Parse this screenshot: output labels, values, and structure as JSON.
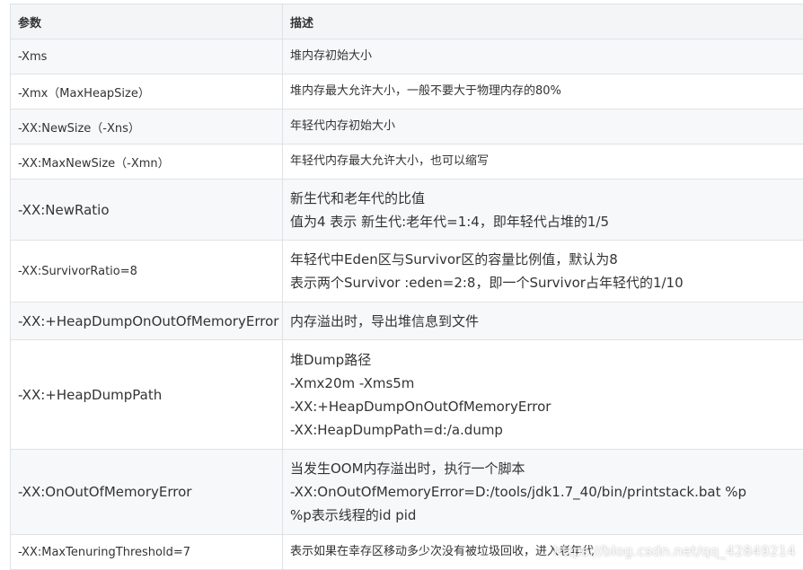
{
  "table": {
    "headers": [
      "参数",
      "描述"
    ],
    "rows": [
      {
        "param": "-Xms",
        "desc": [
          "堆内存初始大小"
        ]
      },
      {
        "param": "-Xmx（MaxHeapSize）",
        "desc": [
          "堆内存最大允许大小，一般不要大于物理内存的80%"
        ]
      },
      {
        "param": "-XX:NewSize（-Xns）",
        "desc": [
          "年轻代内存初始大小"
        ]
      },
      {
        "param": "-XX:MaxNewSize（-Xmn）",
        "desc": [
          "年轻代内存最大允许大小，也可以缩写"
        ]
      },
      {
        "param": "-XX:NewRatio",
        "desc": [
          "新生代和老年代的比值",
          "值为4 表示 新生代:老年代=1:4，即年轻代占堆的1/5"
        ]
      },
      {
        "param": "-XX:SurvivorRatio=8",
        "desc": [
          "年轻代中Eden区与Survivor区的容量比例值，默认为8",
          "表示两个Survivor :eden=2:8，即一个Survivor占年轻代的1/10"
        ]
      },
      {
        "param": "-XX:+HeapDumpOnOutOfMemoryError",
        "desc": [
          "内存溢出时，导出堆信息到文件"
        ]
      },
      {
        "param": "-XX:+HeapDumpPath",
        "desc": [
          "堆Dump路径",
          "-Xmx20m -Xms5m",
          "-XX:+HeapDumpOnOutOfMemoryError",
          "-XX:HeapDumpPath=d:/a.dump"
        ]
      },
      {
        "param": "-XX:OnOutOfMemoryError",
        "desc": [
          "当发生OOM内存溢出时，执行一个脚本",
          "-XX:OnOutOfMemoryError=D:/tools/jdk1.7_40/bin/printstack.bat %p",
          "%p表示线程的id pid"
        ]
      },
      {
        "param": "-XX:MaxTenuringThreshold=7",
        "desc": [
          "表示如果在幸存区移动多少次没有被垃圾回收，进入老年代"
        ]
      }
    ]
  },
  "watermark": "https://blog.csdn.net/qq_42849214"
}
